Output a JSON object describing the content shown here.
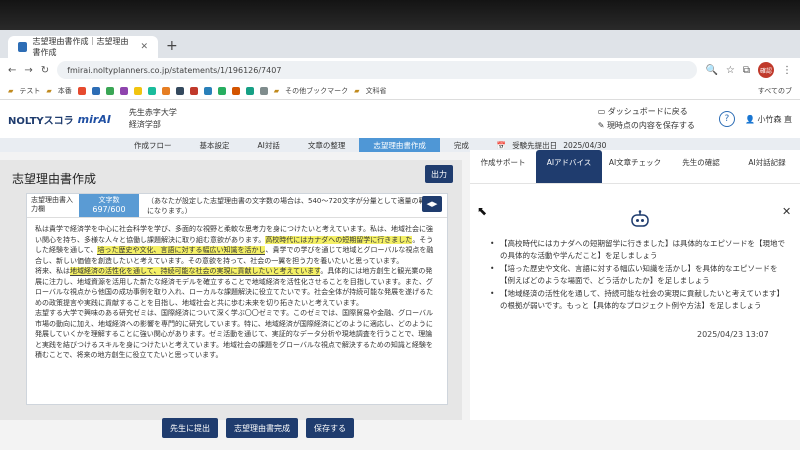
{
  "browser": {
    "tab_title": "志望理由書作成｜志望理由書作成",
    "url": "fmirai.noltyplanners.co.jp/statements/1/196126/7407",
    "profile": "確認"
  },
  "bookmarks": {
    "items": [
      "テスト",
      "本番",
      "その他ブックマーク",
      "文科省"
    ],
    "all": "すべてのブ"
  },
  "header": {
    "logo": "NOLTYスコラ",
    "logo_sub": "mirAI",
    "teacher": "先生赤字大学",
    "dept": "経済学部",
    "dashboard": "ダッシュボードに戻る",
    "save_current": "現時点の内容を保存する",
    "user": "小竹森 直"
  },
  "steps": {
    "items": [
      "作成フロー",
      "基本設定",
      "AI対話",
      "文章の整理",
      "志望理由書作成",
      "完成"
    ],
    "active_index": 4,
    "deadline_label": "受験先提出日",
    "deadline": "2025/04/30"
  },
  "editor": {
    "title": "志望理由書作成",
    "output_button": "出力",
    "label": "志望理由書入力欄",
    "count_label": "文字数",
    "count": "697/600",
    "note": "（あなたが設定した志望理由書の文字数の場合は、540〜720文字が分量として適量の範囲になります。）",
    "p1_a": "私は貴学で経済学を中心に社会科学を学び、多面的な視野と柔軟な思考力を身につけたいと考えています。私は、地域社会に強い関心を持ち、多様な人々と協働し課題解決に取り組む意欲があります。",
    "p1_hl1": "高校時代にはカナダへの短期留学に行きました",
    "p1_b": "。そうした経験を通して、",
    "p1_hl2": "培った歴史や文化、言語に対する幅広い知識を活かし",
    "p1_c": "、貴学での学びを通じて地域とグローバルな視点を融合し、新しい価値を創造したいと考えています。その意欲を持って、社会の一翼を担う力を養いたいと思っています。",
    "p2_a": "将来、私は",
    "p2_hl": "地域経済の活性化を通して、持続可能な社会の実現に貢献したいと考えています",
    "p2_b": "。具体的には地方創生と観光業の発展に注力し、地域資源を活用した新たな経済モデルを確立することで地域経済を活性化させることを目指しています。また、グローバルな視点から他国の成功事例を取り入れ、ローカルな課題解決に役立てたいです。社会全体が持続可能な発展を遂げるための政策提言や実践に貢献することを目指し、地域社会と共に歩む未来を切り拓きたいと考えています。",
    "p3": "志望する大学で興味のある研究ゼミは、国際経済について深く学ぶ〇〇ゼミです。このゼミでは、国際貿易や金融、グローバル市場の動向に加え、地域経済への影響を専門的に研究しています。特に、地域経済が国際経済にどのように適応し、どのように発展していくかを理解することに強い関心があります。ゼミ活動を通じて、実証的なデータ分析や現地調査を行うことで、理論と実践を結びつけるスキルを身につけたいと考えています。地域社会の課題をグローバルな視点で解決するための知識と経験を積むことで、将来の地方創生に役立てたいと思っています。"
  },
  "buttons": {
    "submit": "先生に提出",
    "complete": "志望理由書完成",
    "save": "保存する"
  },
  "right_tabs": [
    "作成サポート",
    "AIアドバイス",
    "AI文章チェック",
    "先生の確認",
    "AI対話記録"
  ],
  "right_tab_active": 1,
  "advice": {
    "items": [
      "【高校時代にはカナダへの短期留学に行きました】は具体的なエピソードを【現地での具体的な活動や学んだこと】を足しましょう",
      "【培った歴史や文化、言語に対する幅広い知識を活かし】を具体的なエピソードを【例えばどのような場面で、どう活かしたか】を足しましょう",
      "【地域経済の活性化を通して、持続可能な社会の実現に貢献したいと考えています】の根拠が弱いです。もっと【具体的なプロジェクト例や方法】を足しましょう"
    ],
    "date": "2025/04/23 13:07"
  }
}
